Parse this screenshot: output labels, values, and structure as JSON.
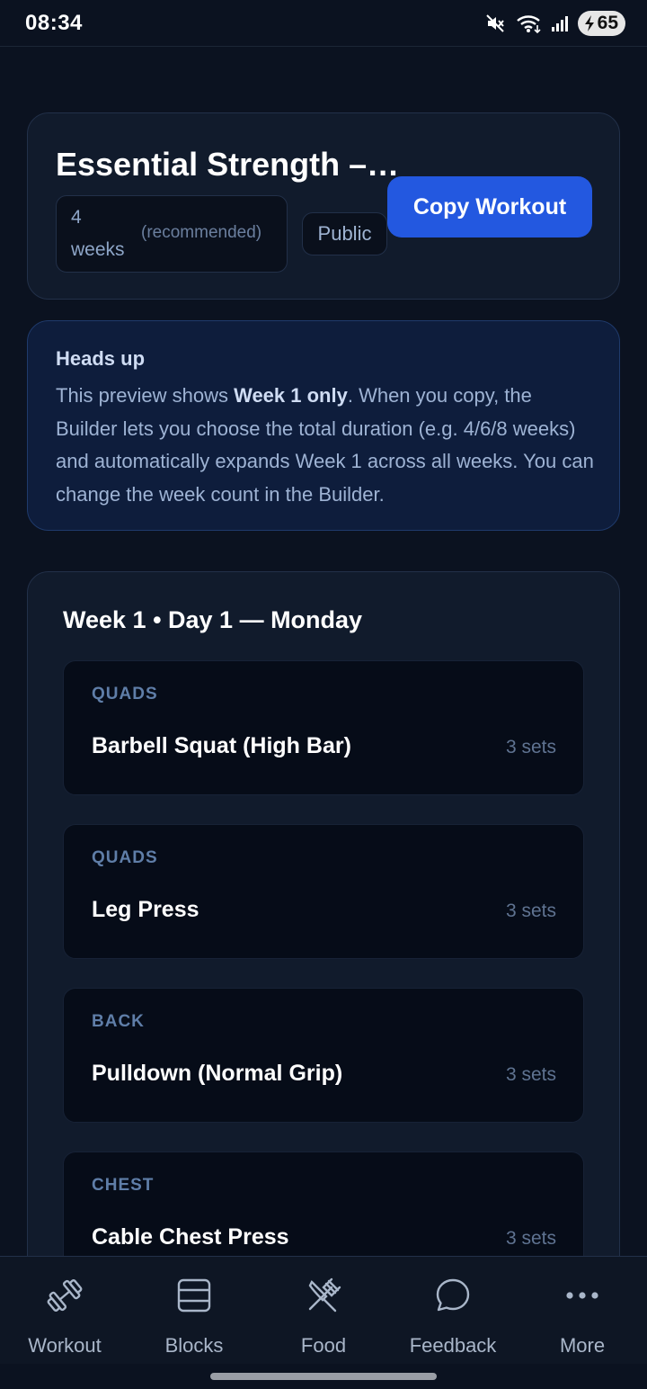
{
  "status_bar": {
    "time": "08:34",
    "battery": "65",
    "icons": [
      "mute-icon",
      "wifi-icon",
      "signal-icon",
      "battery-charging-icon"
    ]
  },
  "plan": {
    "title": "Essential Strength –…",
    "weeks_number": "4",
    "weeks_unit": "weeks",
    "weeks_note": "(recommended)",
    "visibility": "Public",
    "copy_label": "Copy Workout"
  },
  "notice": {
    "title": "Heads up",
    "text_before": "This preview shows ",
    "text_bold": "Week 1 only",
    "text_after": ". When you copy, the Builder lets you choose the total duration (e.g. 4/6/8 weeks) and automatically expands Week 1 across all weeks. You can change the week count in the Builder."
  },
  "day": {
    "title": "Week 1 • Day 1 — Monday",
    "exercises": [
      {
        "group": "QUADS",
        "name": "Barbell Squat (High Bar)",
        "sets": "3 sets"
      },
      {
        "group": "QUADS",
        "name": "Leg Press",
        "sets": "3 sets"
      },
      {
        "group": "BACK",
        "name": "Pulldown (Normal Grip)",
        "sets": "3 sets"
      },
      {
        "group": "CHEST",
        "name": "Cable Chest Press",
        "sets": "3 sets"
      }
    ]
  },
  "nav": {
    "items": [
      {
        "label": "Workout",
        "icon": "dumbbell-icon"
      },
      {
        "label": "Blocks",
        "icon": "blocks-icon"
      },
      {
        "label": "Food",
        "icon": "utensils-icon"
      },
      {
        "label": "Feedback",
        "icon": "chat-bubble-icon"
      },
      {
        "label": "More",
        "icon": "more-dots-icon"
      }
    ]
  },
  "colors": {
    "background": "#0b1220",
    "card": "#111b2c",
    "accent": "#2358e0",
    "notice_bg": "#0e1d3c"
  }
}
